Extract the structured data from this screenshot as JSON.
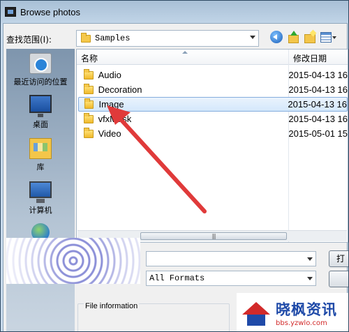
{
  "window": {
    "title": "Browse photos"
  },
  "toolbar": {
    "look_in_label": "查找范围(I):",
    "look_in_value": "Samples",
    "icons": [
      "back-icon",
      "up-folder-icon",
      "new-folder-icon",
      "view-menu-icon"
    ]
  },
  "places": [
    {
      "label": "最近访问的位置",
      "icon": "recent-places-icon"
    },
    {
      "label": "桌面",
      "icon": "desktop-icon"
    },
    {
      "label": "库",
      "icon": "libraries-icon"
    },
    {
      "label": "计算机",
      "icon": "computer-icon"
    },
    {
      "label": "",
      "icon": "network-icon"
    }
  ],
  "filelist": {
    "columns": {
      "name": "名称",
      "date": "修改日期"
    },
    "rows": [
      {
        "name": "Audio",
        "date": "2015-04-13 16",
        "selected": false
      },
      {
        "name": "Decoration",
        "date": "2015-04-13 16",
        "selected": false
      },
      {
        "name": "Image",
        "date": "2015-04-13 16",
        "selected": true
      },
      {
        "name": "vfxMask",
        "date": "2015-04-13 16",
        "selected": false
      },
      {
        "name": "Video",
        "date": "2015-05-01 15",
        "selected": false
      }
    ]
  },
  "lower": {
    "file_type": "All Formats",
    "open_button": "打",
    "file_info_label": "File information"
  },
  "watermark": {
    "title": "晓枫资讯",
    "url": "bbs.yzwlo.com"
  },
  "colors": {
    "annotation_arrow": "#e03a3a",
    "selection": "#d4e8fb"
  }
}
